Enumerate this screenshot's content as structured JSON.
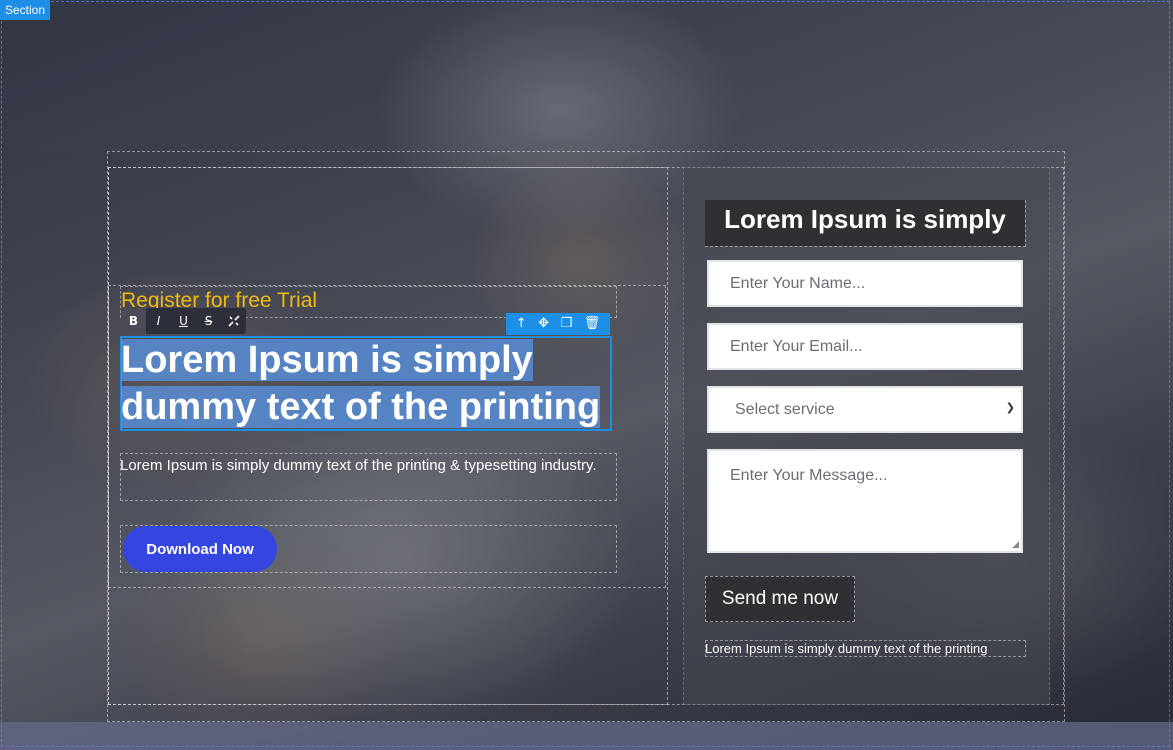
{
  "editor": {
    "section_tag": "Section",
    "rte_buttons": [
      "B",
      "I",
      "U",
      "S"
    ],
    "rte_link_icon": "unlink-icon",
    "element_toolbar_icons": [
      "arrow-up-icon",
      "move-icon",
      "clone-icon",
      "trash-icon"
    ],
    "accent_color": "#1e8fe6"
  },
  "hero": {
    "eyebrow": "Register for free Trial",
    "headline_line1": "Lorem Ipsum is simply",
    "headline_line2": "dummy text of the printing",
    "description": "Lorem Ipsum is simply dummy text of the printing & typesetting industry.",
    "cta_label": "Download Now",
    "eyebrow_color": "#f0b810",
    "cta_color": "#3546e0"
  },
  "form": {
    "title": "Lorem Ipsum is simply",
    "name_placeholder": "Enter Your Name...",
    "email_placeholder": "Enter Your Email...",
    "service_selected": "Select service",
    "message_placeholder": "Enter Your Message...",
    "submit_label": "Send me now",
    "footer_text": "Lorem Ipsum is simply dummy text of the printing"
  }
}
